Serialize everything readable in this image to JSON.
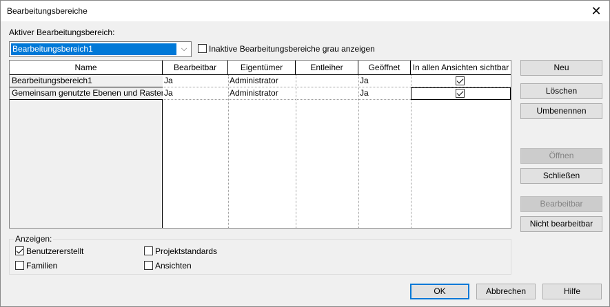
{
  "window": {
    "title": "Bearbeitungsbereiche",
    "close_glyph": "✕"
  },
  "active": {
    "label": "Aktiver Bearbeitungsbereich:",
    "selected": "Bearbeitungsbereich1",
    "dropdown_glyph": "⌵"
  },
  "inactive_gray": {
    "label": "Inaktive Bearbeitungsbereiche grau anzeigen",
    "checked": false
  },
  "table": {
    "columns": [
      "Name",
      "Bearbeitbar",
      "Eigentümer",
      "Entleiher",
      "Geöffnet",
      "In allen Ansichten sichtbar"
    ],
    "rows": [
      {
        "name": "Bearbeitungsbereich1",
        "editable": "Ja",
        "owner": "Administrator",
        "borrower": "",
        "opened": "Ja",
        "visible_all": true
      },
      {
        "name": "Gemeinsam genutzte Ebenen und Raster",
        "editable": "Ja",
        "owner": "Administrator",
        "borrower": "",
        "opened": "Ja",
        "visible_all": true
      }
    ]
  },
  "side_buttons": {
    "new": "Neu",
    "delete": "Löschen",
    "rename": "Umbenennen",
    "open": "Öffnen",
    "close": "Schließen",
    "editable": "Bearbeitbar",
    "not_editable": "Nicht bearbeitbar"
  },
  "show": {
    "label": "Anzeigen:",
    "user_created": {
      "label": "Benutzererstellt",
      "checked": true
    },
    "families": {
      "label": "Familien",
      "checked": false
    },
    "project_standards": {
      "label": "Projektstandards",
      "checked": false
    },
    "views": {
      "label": "Ansichten",
      "checked": false
    }
  },
  "footer": {
    "ok": "OK",
    "cancel": "Abbrechen",
    "help": "Hilfe"
  },
  "colors": {
    "selection": "#0078d7",
    "dialog_bg": "#f0f0f0"
  }
}
